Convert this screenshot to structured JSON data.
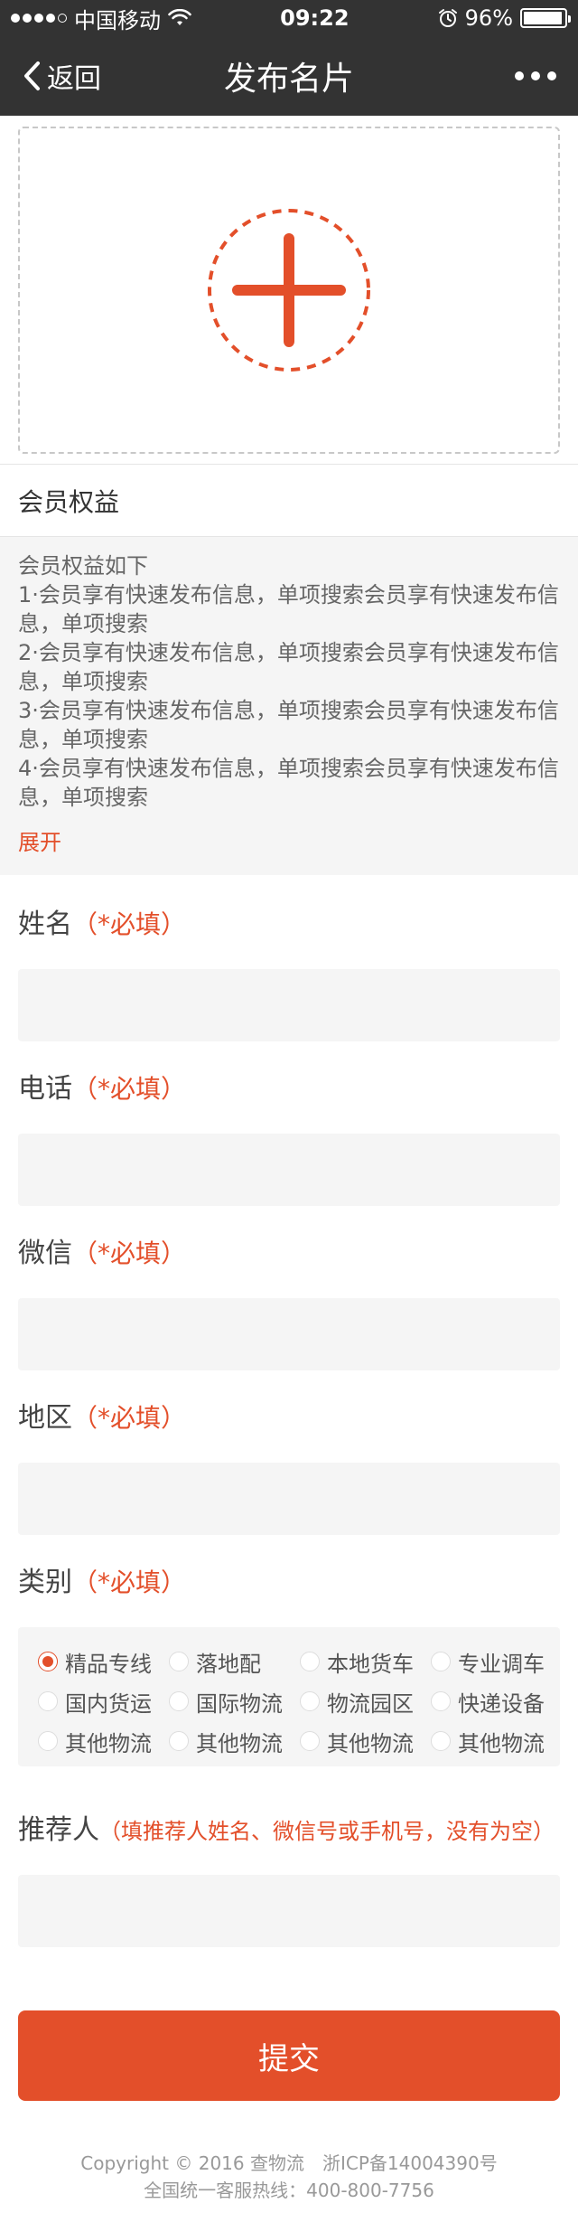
{
  "status_bar": {
    "carrier": "中国移动",
    "time": "09:22",
    "battery": "96%"
  },
  "nav": {
    "back_label": "返回",
    "title": "发布名片"
  },
  "upload": {
    "icon": "plus-icon",
    "accent_color": "#e34f2a"
  },
  "benefits": {
    "header": "会员权益",
    "intro": "会员权益如下",
    "items": [
      "1·会员享有快速发布信息，单项搜索会员享有快速发布信息，单项搜索",
      "2·会员享有快速发布信息，单项搜索会员享有快速发布信息，单项搜索",
      "3·会员享有快速发布信息，单项搜索会员享有快速发布信息，单项搜索",
      "4·会员享有快速发布信息，单项搜索会员享有快速发布信息，单项搜索"
    ],
    "expand_label": "展开"
  },
  "form": {
    "name": {
      "label": "姓名",
      "required": "（*必填）",
      "value": ""
    },
    "phone": {
      "label": "电话",
      "required": "（*必填）",
      "value": ""
    },
    "wechat": {
      "label": "微信",
      "required": "（*必填）",
      "value": ""
    },
    "region": {
      "label": "地区",
      "required": "（*必填）",
      "value": ""
    },
    "category": {
      "label": "类别",
      "required": "（*必填）",
      "selected_index": 0,
      "options": [
        "精品专线",
        "落地配",
        "本地货车",
        "专业调车",
        "国内货运",
        "国际物流",
        "物流园区",
        "快递设备",
        "其他物流",
        "其他物流",
        "其他物流",
        "其他物流"
      ]
    },
    "referrer": {
      "label": "推荐人",
      "hint": "（填推荐人姓名、微信号或手机号，没有为空）",
      "value": ""
    },
    "submit_label": "提交"
  },
  "footer": {
    "copyright": "Copyright © 2016 查物流　浙ICP备14004390号",
    "hotline": "全国统一客服热线：400-800-7756"
  },
  "colors": {
    "accent": "#e34f2a",
    "nav_bg": "#333333",
    "field_bg": "#f5f5f5"
  }
}
